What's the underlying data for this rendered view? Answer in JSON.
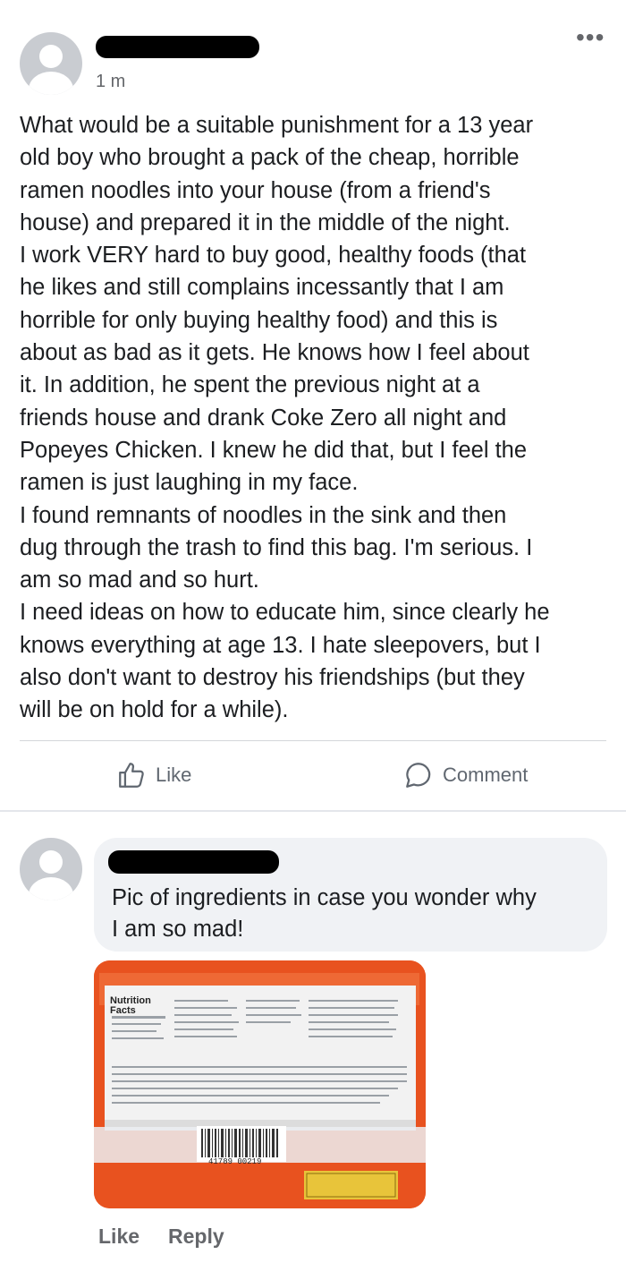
{
  "post": {
    "time": "1 m",
    "more_label": "•••",
    "text": "What would be a suitable punishment for a 13 year\nold boy who brought a pack of the cheap, horrible\nramen noodles into your house (from a friend's\nhouse) and prepared it in the middle of the night.\nI work VERY hard to buy good, healthy foods (that\nhe likes and still complains incessantly that I am\nhorrible for only buying healthy food) and this is\nabout as bad as it gets. He knows how I feel about\nit. In addition, he spent the previous night at a\nfriends house and drank Coke Zero all night and\nPopeyes Chicken. I knew he did that, but I feel the\nramen is just laughing in my face.\nI found remnants of noodles in the sink and then\ndug through the trash to find this bag. I'm serious. I\nam so mad and so hurt.\nI need ideas on how to educate him, since clearly he\nknows everything at age 13. I hate sleepovers, but I\nalso don't want to destroy his friendships (but they\nwill be on hold for a while).",
    "like_label": "Like",
    "comment_label": "Comment"
  },
  "comment": {
    "text": "Pic of ingredients in case you wonder why\nI am so mad!",
    "like_label": "Like",
    "reply_label": "Reply"
  },
  "photo": {
    "nutrition_label": "Nutrition Facts",
    "barcode_number": "41789 00219"
  },
  "colors": {
    "text": "#1c1e21",
    "meta": "#65676b",
    "bubble": "#f0f2f5",
    "package_orange": "#e8521f"
  }
}
